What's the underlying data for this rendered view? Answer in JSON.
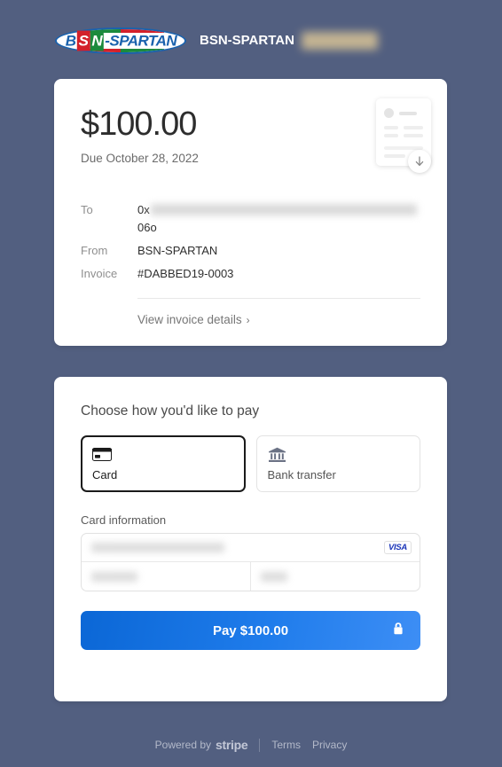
{
  "header": {
    "logo": {
      "letter_b": "B",
      "letter_s": "S",
      "letter_n": "N",
      "rest": "-SPARTAN"
    },
    "merchant_name": "BSN-SPARTAN",
    "redacted_chip_color": "#d8c396"
  },
  "summary": {
    "amount": "$100.00",
    "due_date": "Due October 28, 2022",
    "details": [
      {
        "label": "To",
        "value": "0x",
        "value_line2": "06o",
        "redacted": true
      },
      {
        "label": "From",
        "value": "BSN-SPARTAN",
        "redacted": false
      },
      {
        "label": "Invoice",
        "value": "#DABBED19-0003",
        "redacted": false
      }
    ],
    "view_details_link": "View invoice details",
    "chevron": "›"
  },
  "payment": {
    "section_title": "Choose how you'd like to pay",
    "methods": [
      {
        "label": "Card",
        "icon": "credit-card-icon",
        "selected": true
      },
      {
        "label": "Bank transfer",
        "icon": "bank-icon",
        "selected": false
      }
    ],
    "card_information_label": "Card information",
    "card_brand": "VISA",
    "pay_button_label": "Pay $100.00",
    "button_accent": "#1f7ceb"
  },
  "footer": {
    "powered_by": "Powered by",
    "stripe": "stripe",
    "terms": "Terms",
    "privacy": "Privacy"
  }
}
